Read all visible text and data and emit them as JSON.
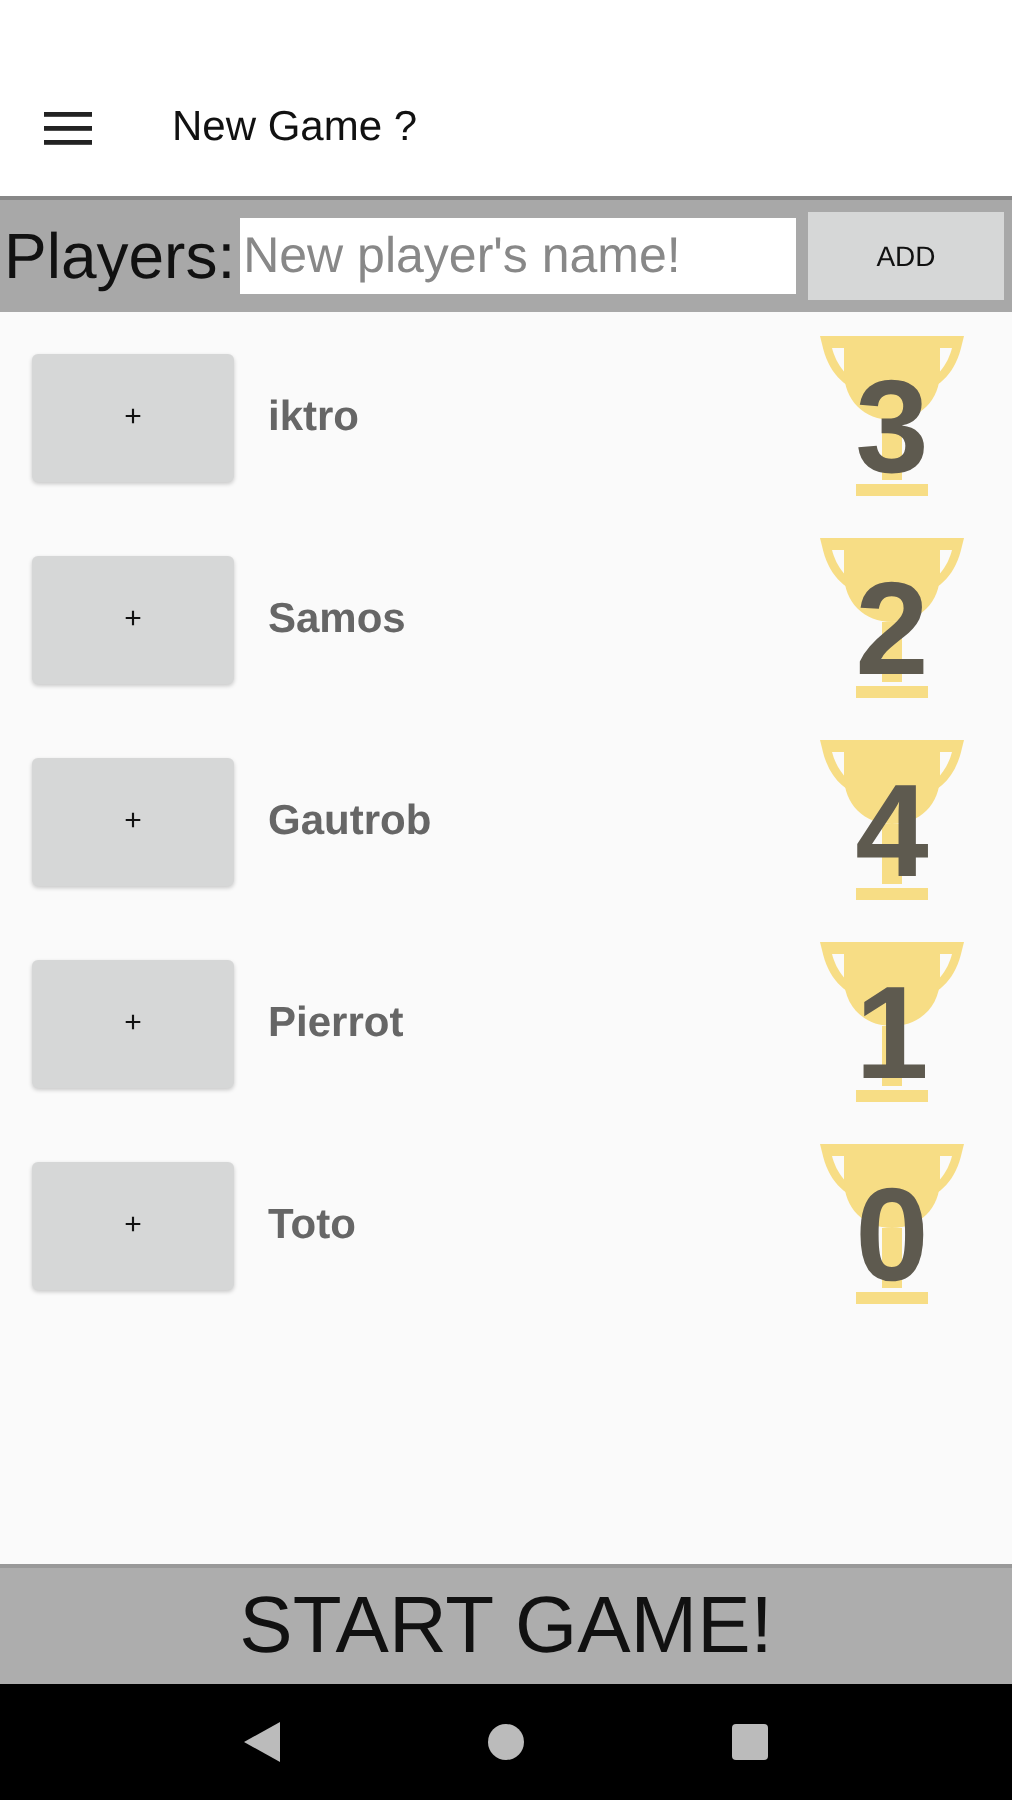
{
  "toolbar": {
    "title": "New Game ?"
  },
  "players_bar": {
    "label": "Players:",
    "input": {
      "placeholder": "New player's name!"
    },
    "add_button": "ADD"
  },
  "players": [
    {
      "button": "+",
      "name": "iktro",
      "score": "3"
    },
    {
      "button": "+",
      "name": "Samos",
      "score": "2"
    },
    {
      "button": "+",
      "name": "Gautrob",
      "score": "4"
    },
    {
      "button": "+",
      "name": "Pierrot",
      "score": "1"
    },
    {
      "button": "+",
      "name": "Toto",
      "score": "0"
    }
  ],
  "start_button": "START GAME!"
}
